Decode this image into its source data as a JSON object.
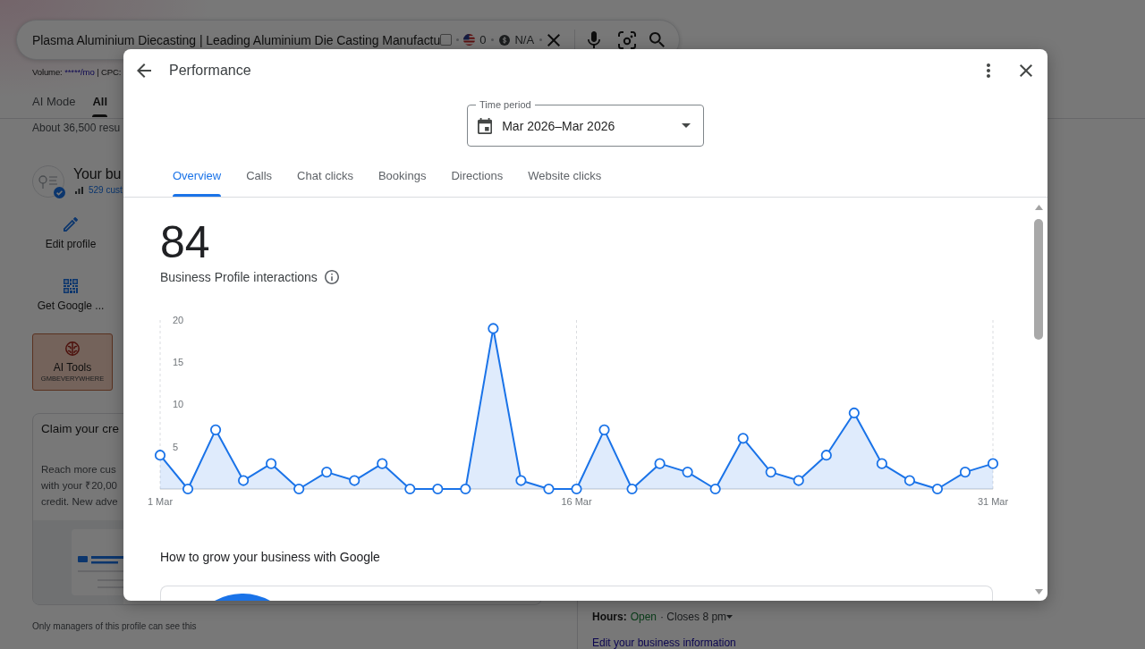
{
  "search_page": {
    "search_box": {
      "value": "Plasma Aluminium Diecasting | Leading Aluminium Die Casting Manufactu",
      "checked": false,
      "flag_value": "0",
      "coin_value": "N/A"
    },
    "keyword_stats": {
      "label": "Volume:",
      "volume": "*****/mo",
      "rest": "| CPC:"
    },
    "tabs": [
      {
        "label": "AI Mode",
        "selected": false
      },
      {
        "label": "All",
        "selected": true
      }
    ],
    "result_count": "About 36,500 resu",
    "business_profile": {
      "name": "Your bu",
      "customers": "529 cust",
      "actions": [
        {
          "kind": "edit",
          "label": "Edit profile"
        },
        {
          "kind": "qr",
          "label": "Get Google ..."
        }
      ],
      "ai_tools": {
        "title": "AI Tools",
        "subtitle": "GMBEVERYWHERE"
      },
      "promo_card": {
        "title": "Claim your cre",
        "body_lines": [
          "Reach more cus",
          "with your ₹20,00",
          "credit. New adve"
        ]
      },
      "note": "Only managers of this profile can see this"
    },
    "hours": {
      "label": "Hours:",
      "status": "Open",
      "closes": "· Closes 8 pm"
    },
    "edit_link": "Edit your business information"
  },
  "dialog": {
    "title": "Performance",
    "time_period": {
      "label": "Time period",
      "value": "Mar 2026–Mar 2026"
    },
    "tabs": [
      {
        "label": "Overview",
        "selected": true
      },
      {
        "label": "Calls",
        "selected": false
      },
      {
        "label": "Chat clicks",
        "selected": false
      },
      {
        "label": "Bookings",
        "selected": false
      },
      {
        "label": "Directions",
        "selected": false
      },
      {
        "label": "Website clicks",
        "selected": false
      }
    ],
    "total": "84",
    "metric_label": "Business Profile interactions",
    "chart_data": {
      "type": "area",
      "categories": [
        "1 Mar",
        null,
        null,
        null,
        null,
        null,
        null,
        null,
        null,
        null,
        null,
        null,
        null,
        null,
        null,
        "16 Mar",
        null,
        null,
        null,
        null,
        null,
        null,
        null,
        null,
        null,
        null,
        null,
        null,
        null,
        null,
        "31 Mar"
      ],
      "ylim": [
        0,
        20
      ],
      "yticks": [
        5,
        10,
        15,
        20
      ],
      "series": [
        {
          "color": "#1a73e8",
          "values": [
            4,
            0,
            7,
            1,
            3,
            0,
            2,
            1,
            3,
            0,
            0,
            0,
            19,
            1,
            0,
            0,
            7,
            0,
            3,
            2,
            0,
            6,
            2,
            1,
            4,
            9,
            3,
            1,
            0,
            2,
            3
          ]
        }
      ]
    },
    "section_title": "How to grow your business with Google"
  }
}
